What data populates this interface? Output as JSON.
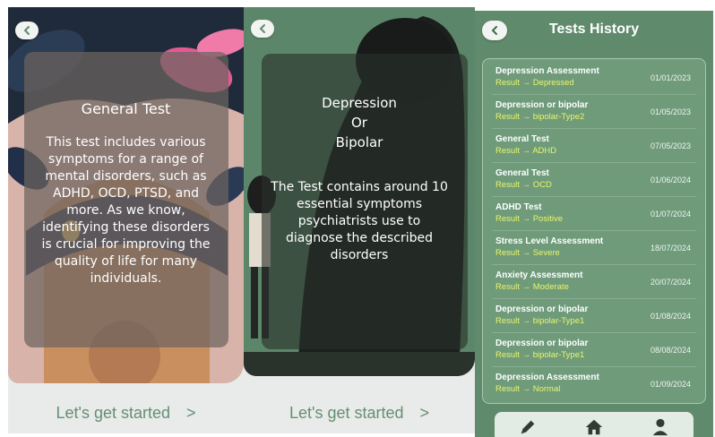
{
  "screen1": {
    "title": "General Test",
    "body": "This test includes various symptoms for a range of mental disorders, such as ADHD, OCD, PTSD, and more. As we know, identifying these disorders is crucial for improving the quality of life for many individuals.",
    "cta": "Let's get started",
    "cta_arrow": ">"
  },
  "screen2": {
    "title_line1": "Depression",
    "title_line2": "Or",
    "title_line3": "Bipolar",
    "body": "The Test contains around 10 essential symptoms psychiatrists use to diagnose the described disorders",
    "cta": "Let's get started",
    "cta_arrow": ">"
  },
  "history": {
    "title": "Tests History",
    "result_prefix": "Result →",
    "items": [
      {
        "test": "Depression Assessment",
        "result": "Depressed",
        "date": "01/01/2023"
      },
      {
        "test": "Depression or bipolar",
        "result": "bipolar-Type2",
        "date": "01/05/2023"
      },
      {
        "test": "General Test",
        "result": "ADHD",
        "date": "07/05/2023"
      },
      {
        "test": "General Test",
        "result": "OCD",
        "date": "01/06/2024"
      },
      {
        "test": "ADHD Test",
        "result": "Positive",
        "date": "01/07/2024"
      },
      {
        "test": "Stress Level Assessment",
        "result": "Severe",
        "date": "18/07/2024"
      },
      {
        "test": "Anxiety Assessment",
        "result": "Moderate",
        "date": "20/07/2024"
      },
      {
        "test": "Depression or bipolar",
        "result": "bipolar-Type1",
        "date": "01/08/2024"
      },
      {
        "test": "Depression or bipolar",
        "result": "bipolar-Type1",
        "date": "08/08/2024"
      },
      {
        "test": "Depression Assessment",
        "result": "Normal",
        "date": "01/09/2024"
      }
    ],
    "nav_icons": [
      "pencil-icon",
      "home-icon",
      "user-icon"
    ]
  },
  "colors": {
    "accent_green": "#5f8a6c",
    "result_yellow": "#e8f56a",
    "cta_green": "#648f70"
  }
}
